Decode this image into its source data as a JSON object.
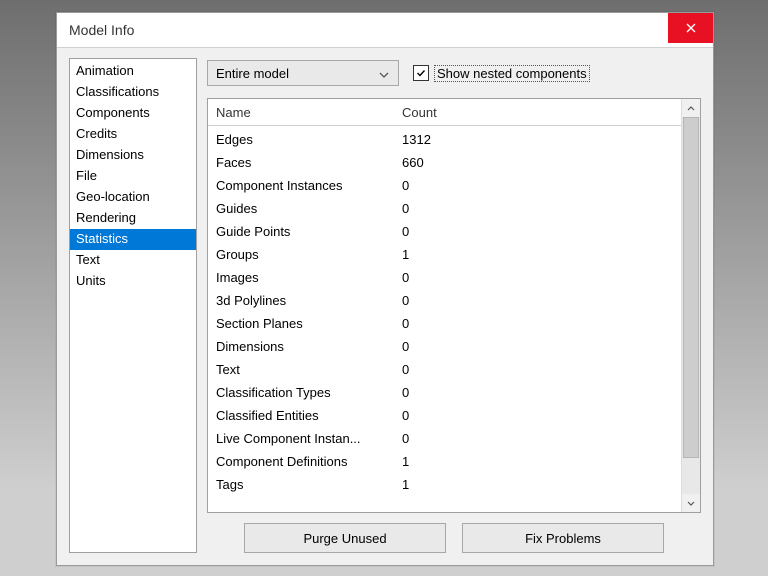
{
  "window": {
    "title": "Model Info",
    "close_icon": "close-icon"
  },
  "sidebar": {
    "items": [
      {
        "label": "Animation"
      },
      {
        "label": "Classifications"
      },
      {
        "label": "Components"
      },
      {
        "label": "Credits"
      },
      {
        "label": "Dimensions"
      },
      {
        "label": "File"
      },
      {
        "label": "Geo-location"
      },
      {
        "label": "Rendering"
      },
      {
        "label": "Statistics",
        "selected": true
      },
      {
        "label": "Text"
      },
      {
        "label": "Units"
      }
    ]
  },
  "controls": {
    "scope_dropdown": {
      "selected": "Entire model"
    },
    "show_nested": {
      "label": "Show nested components",
      "checked": true
    }
  },
  "table": {
    "columns": {
      "name": "Name",
      "count": "Count"
    },
    "rows": [
      {
        "name": "Edges",
        "count": "1312"
      },
      {
        "name": "Faces",
        "count": "660"
      },
      {
        "name": "Component Instances",
        "count": "0"
      },
      {
        "name": "Guides",
        "count": "0"
      },
      {
        "name": "Guide Points",
        "count": "0"
      },
      {
        "name": "Groups",
        "count": "1"
      },
      {
        "name": "Images",
        "count": "0"
      },
      {
        "name": "3d Polylines",
        "count": "0"
      },
      {
        "name": "Section Planes",
        "count": "0"
      },
      {
        "name": "Dimensions",
        "count": "0"
      },
      {
        "name": "Text",
        "count": "0"
      },
      {
        "name": "Classification Types",
        "count": "0"
      },
      {
        "name": "Classified Entities",
        "count": "0"
      },
      {
        "name": "Live Component Instan...",
        "count": "0"
      },
      {
        "name": "Component Definitions",
        "count": "1"
      },
      {
        "name": "Tags",
        "count": "1"
      }
    ]
  },
  "buttons": {
    "purge": "Purge Unused",
    "fix": "Fix Problems"
  }
}
